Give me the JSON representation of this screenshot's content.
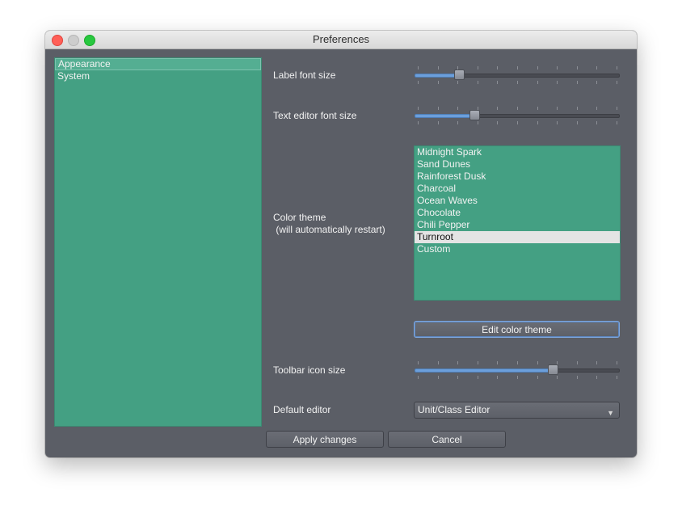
{
  "window": {
    "title": "Preferences"
  },
  "categories": [
    {
      "label": "Appearance",
      "selected": true
    },
    {
      "label": "System",
      "selected": false
    }
  ],
  "settings": {
    "label_font_size": {
      "label": "Label font size",
      "value_fraction": 0.2
    },
    "text_editor_font_size": {
      "label": "Text editor font size",
      "value_fraction": 0.28
    },
    "color_theme": {
      "label": "Color theme\n (will automatically restart)",
      "options": [
        "Midnight Spark",
        "Sand Dunes",
        "Rainforest Dusk",
        "Charcoal",
        "Ocean Waves",
        "Chocolate",
        "Chili Pepper",
        "Turnroot",
        "Custom"
      ],
      "selected": "Turnroot",
      "edit_button": "Edit color theme"
    },
    "toolbar_icon_size": {
      "label": "Toolbar icon size",
      "value_fraction": 0.68
    },
    "default_editor": {
      "label": "Default editor",
      "value": "Unit/Class Editor"
    }
  },
  "footer": {
    "apply": "Apply changes",
    "cancel": "Cancel"
  },
  "colors": {
    "panel_bg": "#5b5e66",
    "list_bg": "#44a083",
    "accent": "#6c9fdb"
  }
}
